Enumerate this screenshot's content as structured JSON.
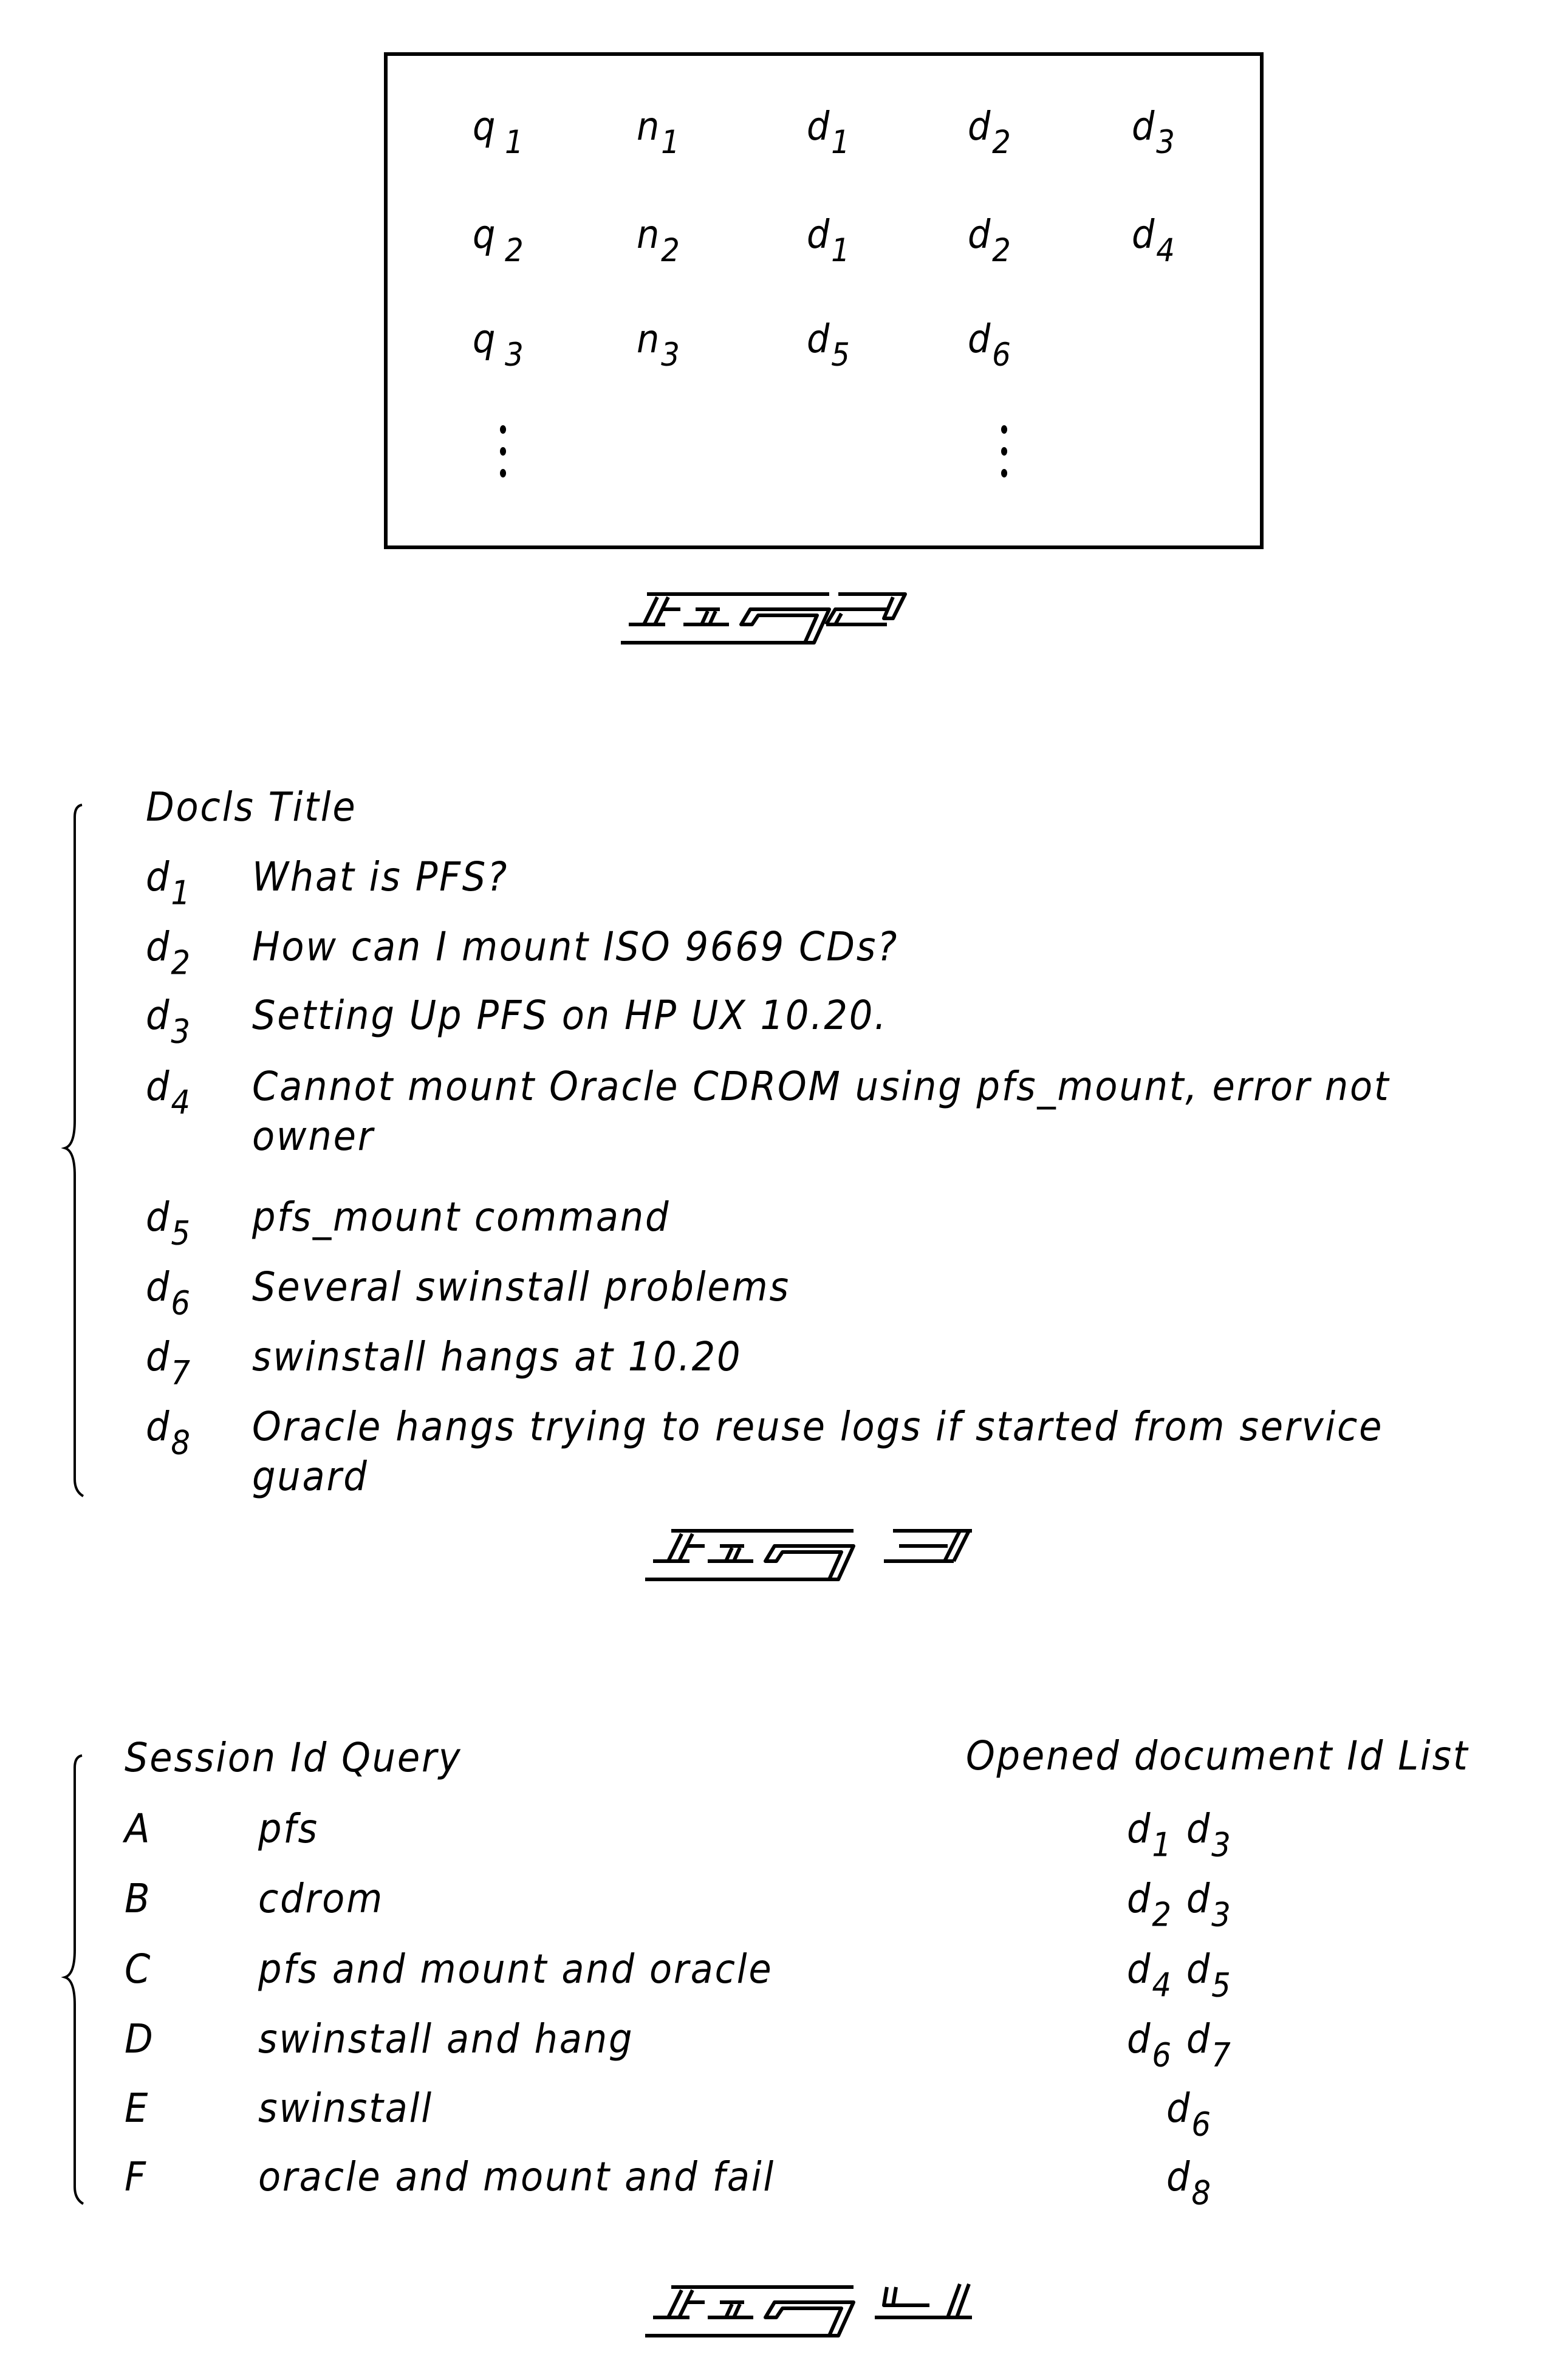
{
  "fig2": {
    "label": "FIG 2",
    "rows": [
      {
        "query": "q",
        "query_sub": "1",
        "count": "n",
        "count_sub": "1",
        "docs": [
          {
            "d": "d",
            "sub": "1"
          },
          {
            "d": "d",
            "sub": "2"
          },
          {
            "d": "d",
            "sub": "3"
          }
        ]
      },
      {
        "query": "q",
        "query_sub": "2",
        "count": "n",
        "count_sub": "2",
        "docs": [
          {
            "d": "d",
            "sub": "1"
          },
          {
            "d": "d",
            "sub": "2"
          },
          {
            "d": "d",
            "sub": "4"
          }
        ]
      },
      {
        "query": "q",
        "query_sub": "3",
        "count": "n",
        "count_sub": "3",
        "docs": [
          {
            "d": "d",
            "sub": "5"
          },
          {
            "d": "d",
            "sub": "6"
          }
        ]
      }
    ],
    "continuation": "⋮"
  },
  "fig3": {
    "label": "FIG 3",
    "header": "Docls  Title",
    "rows": [
      {
        "id": "d",
        "sub": "1",
        "title": "What is PFS?"
      },
      {
        "id": "d",
        "sub": "2",
        "title": "How can I mount ISO 9669 CDs?"
      },
      {
        "id": "d",
        "sub": "3",
        "title": "Setting Up PFS on HP UX 10.20."
      },
      {
        "id": "d",
        "sub": "4",
        "title": "Cannot mount Oracle CDROM using pfs_mount, error not",
        "title_cont": "owner"
      },
      {
        "id": "d",
        "sub": "5",
        "title": "pfs_mount command"
      },
      {
        "id": "d",
        "sub": "6",
        "title": "Several swinstall problems"
      },
      {
        "id": "d",
        "sub": "7",
        "title": "swinstall hangs at 10.20"
      },
      {
        "id": "d",
        "sub": "8",
        "title": "Oracle hangs trying to reuse logs if started from service",
        "title_cont": "guard"
      }
    ]
  },
  "fig4": {
    "label": "FIG 4",
    "header_left": "Session Id Query",
    "header_right": "Opened document Id List",
    "rows": [
      {
        "session": "A",
        "query": "pfs",
        "docs": [
          {
            "d": "d",
            "sub": "1"
          },
          {
            "d": "d",
            "sub": "3"
          }
        ]
      },
      {
        "session": "B",
        "query": "cdrom",
        "docs": [
          {
            "d": "d",
            "sub": "2"
          },
          {
            "d": "d",
            "sub": "3"
          }
        ]
      },
      {
        "session": "C",
        "query": "pfs and mount and oracle",
        "docs": [
          {
            "d": "d",
            "sub": "4"
          },
          {
            "d": "d",
            "sub": "5"
          }
        ]
      },
      {
        "session": "D",
        "query": "swinstall and hang",
        "docs": [
          {
            "d": "d",
            "sub": "6"
          },
          {
            "d": "d",
            "sub": "7"
          }
        ]
      },
      {
        "session": "E",
        "query": "swinstall",
        "docs": [
          {
            "d": "d",
            "sub": "6"
          }
        ]
      },
      {
        "session": "F",
        "query": "oracle and mount and fail",
        "docs": [
          {
            "d": "d",
            "sub": "8"
          }
        ]
      }
    ]
  }
}
